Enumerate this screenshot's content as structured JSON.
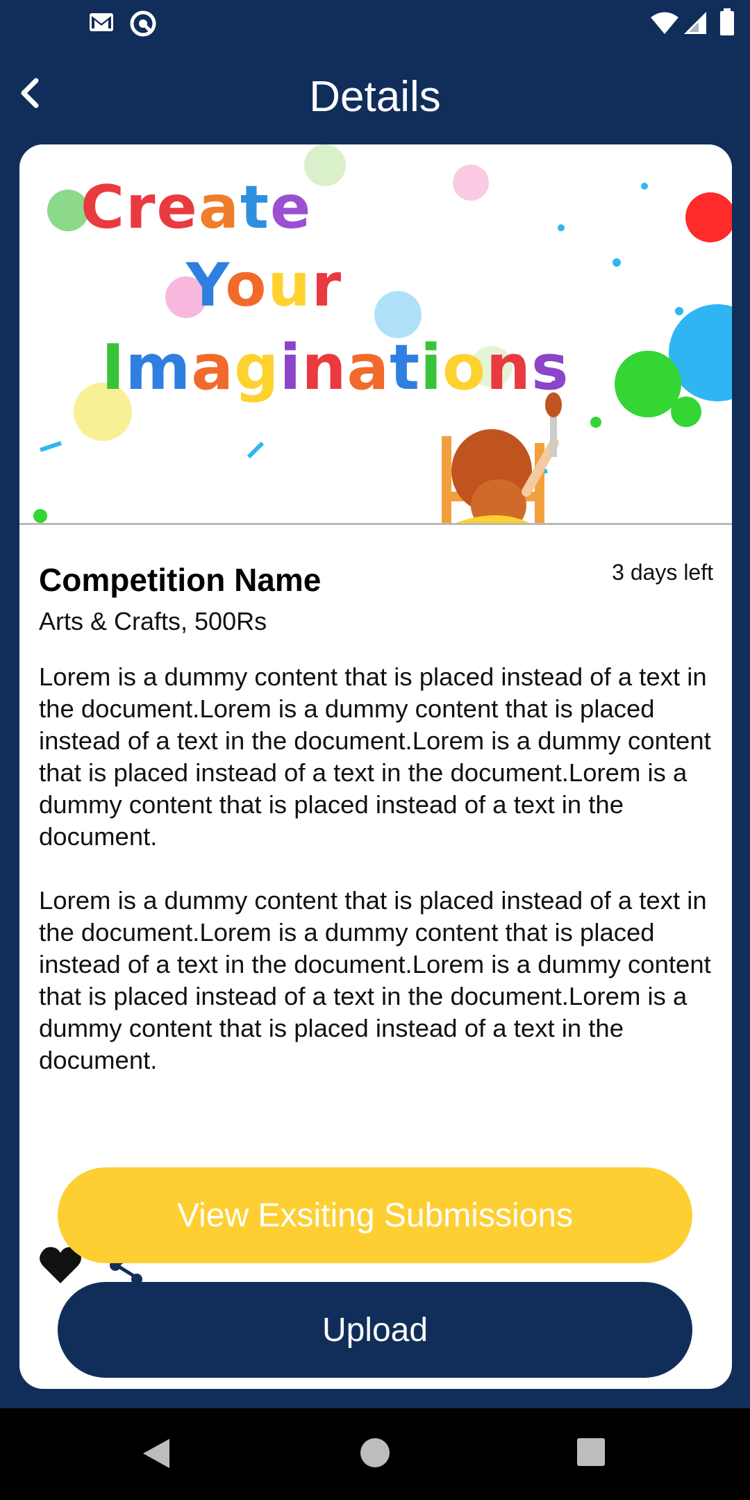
{
  "header": {
    "title": "Details"
  },
  "competition": {
    "name": "Competition Name",
    "category_fee": "Arts & Crafts, 500Rs",
    "time_left": "3 days left",
    "banner_lines": [
      "Create",
      "Your",
      "Imaginations"
    ],
    "description": [
      "Lorem is a dummy content that is placed instead of a text in the document.Lorem is a dummy content that is placed instead of a text in the document.Lorem is a dummy content that is placed instead of a text in the document.Lorem is a dummy content that is placed instead of a text in the document.",
      "Lorem is a dummy content that is placed instead of a text in the document.Lorem is a dummy content that is placed instead of a text in the document.Lorem is a dummy content that is placed instead of a text in the document.Lorem is a dummy content that is placed instead of a text in the document."
    ]
  },
  "buttons": {
    "view_submissions": "View Exsiting Submissions",
    "upload": "Upload"
  },
  "icons": {
    "status_left": [
      "gmail-icon",
      "sync-icon"
    ],
    "status_right": [
      "wifi-icon",
      "signal-icon",
      "battery-icon"
    ],
    "actions": [
      "heart-icon",
      "share-icon"
    ],
    "nav": [
      "back-triangle-icon",
      "home-circle-icon",
      "recents-square-icon"
    ]
  },
  "colors": {
    "primary": "#112e5a",
    "accent": "#fdcf33",
    "card": "#ffffff"
  }
}
